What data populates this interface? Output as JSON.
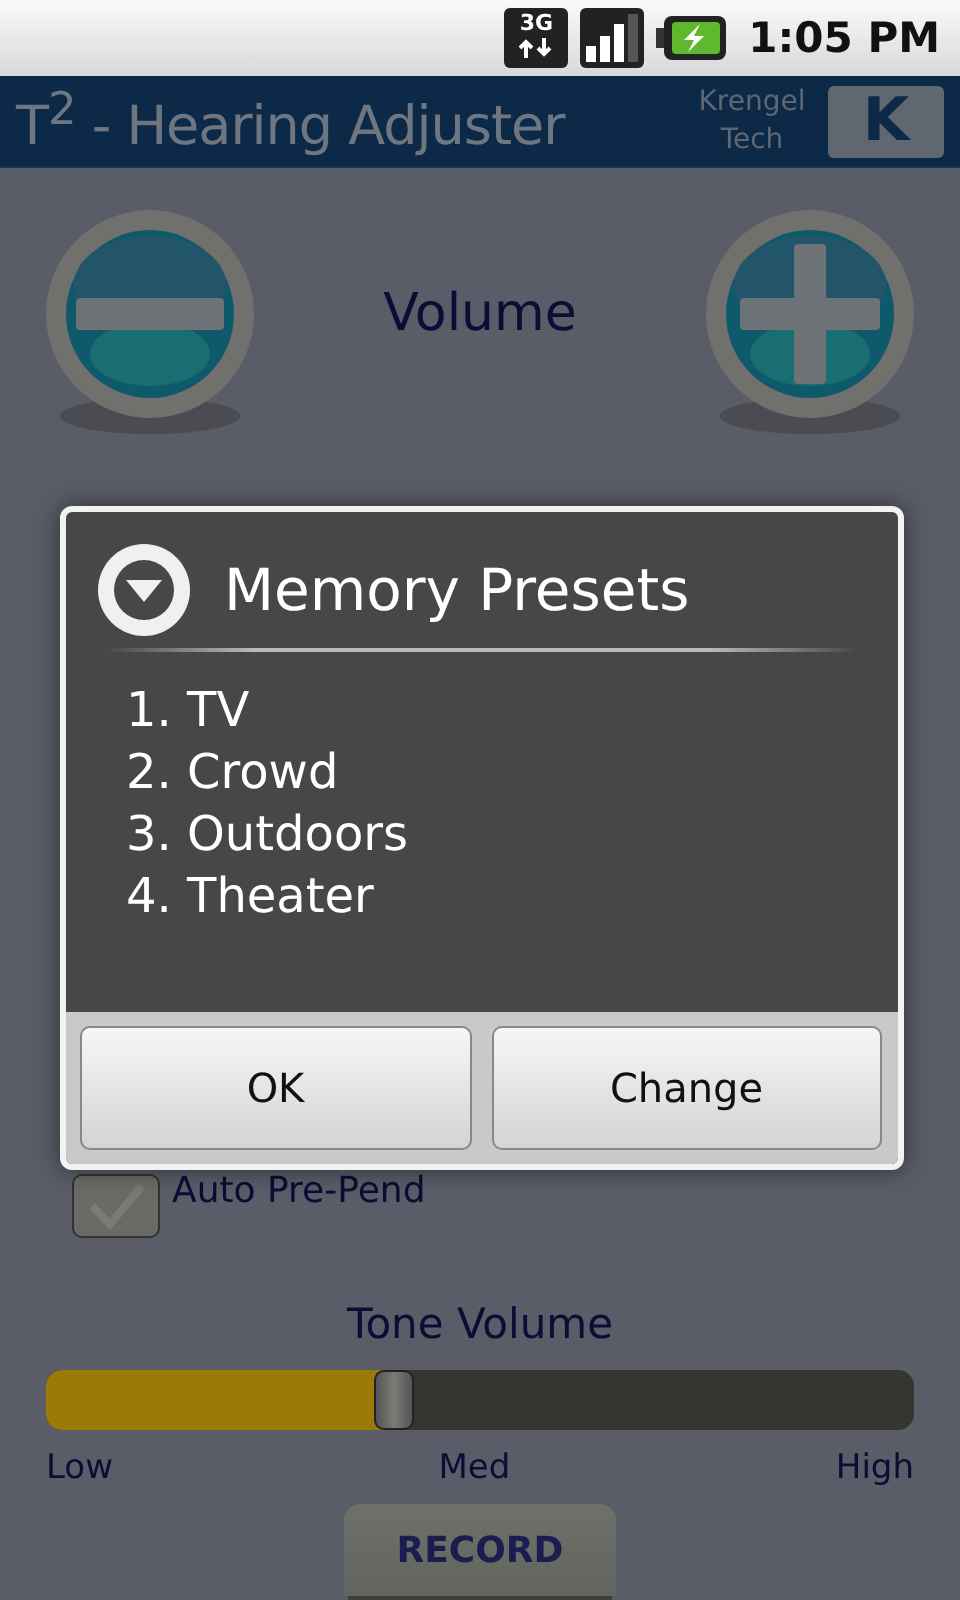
{
  "status_bar": {
    "network": "3G",
    "time": "1:05 PM"
  },
  "title_bar": {
    "title": "T$^{2}$ - Hearing Adjuster",
    "company": "Krengel Tech",
    "logo": "K"
  },
  "volume": {
    "label": "Volume"
  },
  "dialog": {
    "title": "Memory Presets",
    "items": [
      "1. TV",
      "2. Crowd",
      "3. Outdoors",
      "4. Theater"
    ],
    "buttons": [
      "OK",
      "Change"
    ]
  },
  "auto_prepend": {
    "label": "Auto Pre-Pend",
    "checked": true
  },
  "tone_volume": {
    "label": "Tone Volume",
    "level": 0.4,
    "ticks": [
      "Low",
      "Med",
      "High"
    ]
  },
  "record_button": {
    "label": "RECORD"
  }
}
